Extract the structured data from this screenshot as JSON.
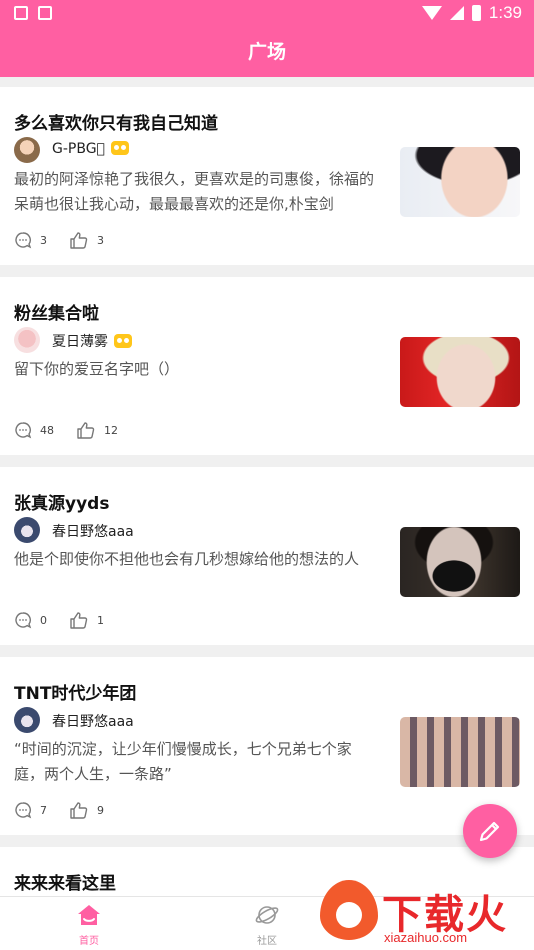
{
  "status_bar": {
    "time": "1:39"
  },
  "header": {
    "title": "广场"
  },
  "posts": [
    {
      "title": "多么喜欢你只有我自己知道",
      "username": "G-PBG⃝",
      "vip": true,
      "content": "最初的阿泽惊艳了我很久，更喜欢是的司惠俊，徐福的呆萌也很让我心动，最最最喜欢的还是你,朴宝剑",
      "comments": "3",
      "likes": "3"
    },
    {
      "title": "粉丝集合啦",
      "username": "夏日薄雾",
      "vip": true,
      "content": "留下你的爱豆名字吧（）",
      "comments": "48",
      "likes": "12"
    },
    {
      "title": "张真源yyds",
      "username": "春日野悠aaa",
      "vip": false,
      "content": "他是个即使你不担他也会有几秒想嫁给他的想法的人",
      "comments": "0",
      "likes": "1"
    },
    {
      "title": "TNT时代少年团",
      "username": "春日野悠aaa",
      "vip": false,
      "content": "“时间的沉淀，让少年们慢慢成长，七个兄弟七个家庭，两个人生，一条路”",
      "comments": "7",
      "likes": "9"
    },
    {
      "title": "来来来看这里",
      "username": "",
      "vip": true,
      "content": "",
      "comments": "",
      "likes": ""
    }
  ],
  "tabs": {
    "home": "首页",
    "community": "社区"
  },
  "watermark": {
    "text": "下载火",
    "url": "xiazaihuo.com"
  },
  "colors": {
    "accent": "#ff5fa2",
    "watermark": "#e8282b"
  },
  "icons": [
    "comment-icon",
    "like-icon",
    "edit-icon",
    "home-icon",
    "planet-icon"
  ]
}
